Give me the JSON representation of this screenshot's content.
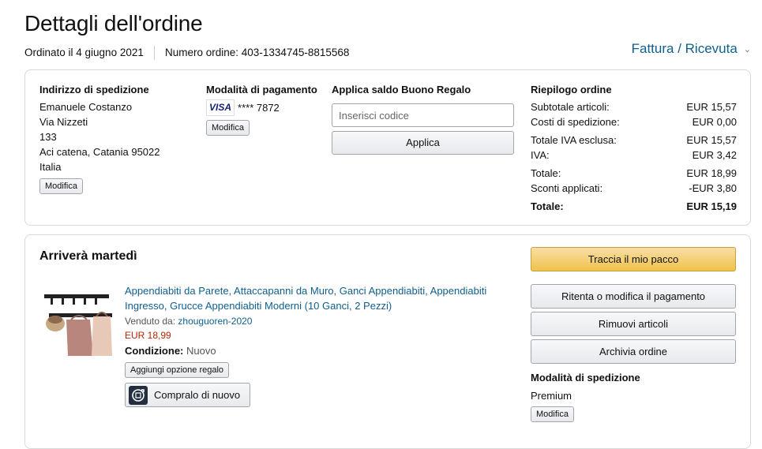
{
  "header": {
    "title": "Dettagli dell'ordine",
    "ordered_on": "Ordinato il 4 giugno 2021",
    "order_number": "Numero ordine: 403-1334745-8815568",
    "invoice_link": "Fattura / Ricevuta",
    "invoice_chevron": "⌄"
  },
  "shipping": {
    "heading": "Indirizzo di spedizione",
    "name": "Emanuele Costanzo",
    "street": "Via Nizzeti",
    "number": "133",
    "city": "Aci catena, Catania 95022",
    "country": "Italia",
    "edit_label": "Modifica"
  },
  "payment": {
    "heading": "Modalità di pagamento",
    "card_brand": "VISA",
    "card_masked": "**** 7872",
    "edit_label": "Modifica"
  },
  "gift": {
    "heading": "Applica saldo Buono Regalo",
    "placeholder": "Inserisci codice",
    "apply_label": "Applica"
  },
  "summary": {
    "heading": "Riepilogo ordine",
    "rows": [
      {
        "label": "Subtotale articoli:",
        "value": "EUR 15,57"
      },
      {
        "label": "Costi di spedizione:",
        "value": "EUR 0,00"
      },
      {
        "label": "Totale IVA esclusa:",
        "value": "EUR 15,57"
      },
      {
        "label": "IVA:",
        "value": "EUR 3,42"
      },
      {
        "label": "Totale:",
        "value": "EUR 18,99"
      },
      {
        "label": "Sconti applicati:",
        "value": "-EUR 3,80"
      }
    ],
    "grand_total_label": "Totale:",
    "grand_total_value": "EUR 15,19"
  },
  "shipment": {
    "arrival": "Arriverà martedì",
    "item_title": "Appendiabiti da Parete, Attaccapanni da Muro, Ganci Appendiabiti, Appendiabiti Ingresso, Grucce Appendiabiti Moderni (10 Ganci, 2 Pezzi)",
    "sold_by_label": "Venduto da:",
    "seller": "zhouguoren-2020",
    "price": "EUR 18,99",
    "condition_label": "Condizione:",
    "condition_value": "Nuovo",
    "gift_option_label": "Aggiungi opzione regalo",
    "buy_again_label": "Compralo di nuovo"
  },
  "actions": {
    "track": "Traccia il mio pacco",
    "retry_payment": "Ritenta o modifica il pagamento",
    "remove_items": "Rimuovi articoli",
    "archive": "Archivia ordine",
    "shipping_mode_heading": "Modalità di spedizione",
    "shipping_mode_value": "Premium",
    "edit_label": "Modifica"
  },
  "colors": {
    "link": "#0f5f8f",
    "price": "#b12704",
    "track_button": "#f0c14b"
  }
}
